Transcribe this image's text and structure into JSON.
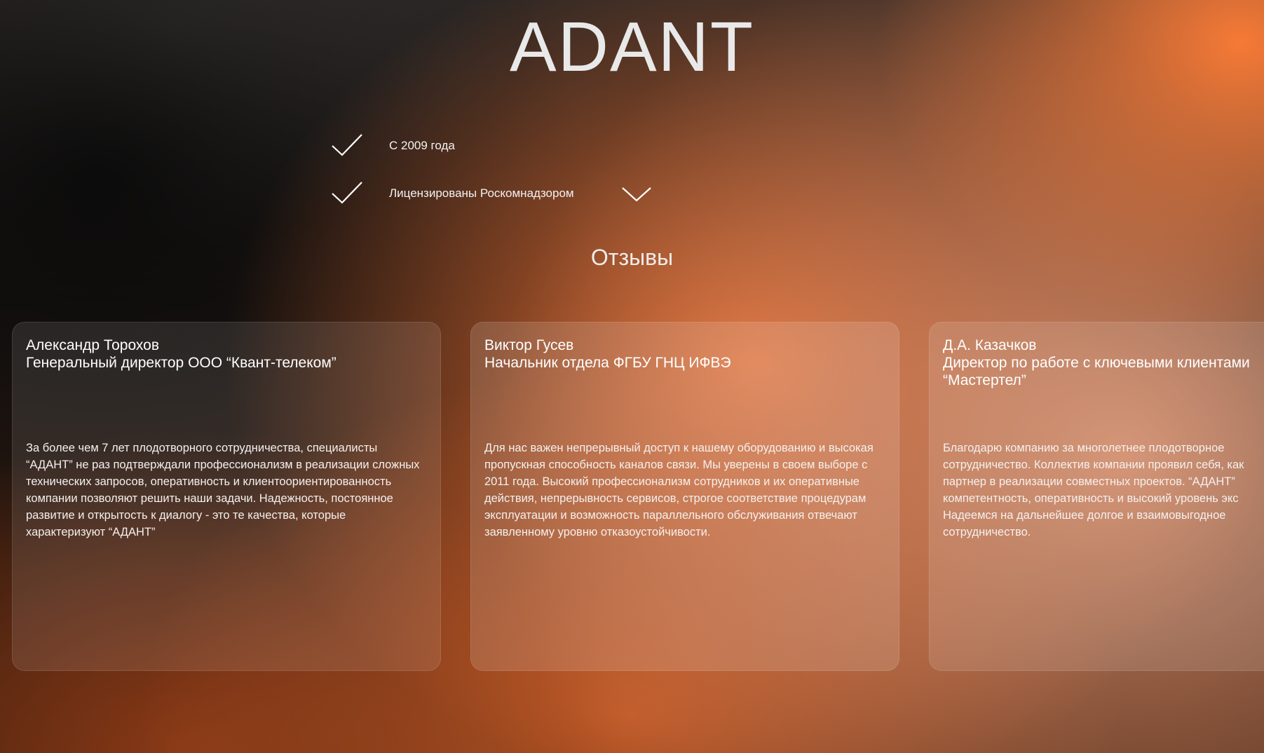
{
  "brand": {
    "title": "ADANT"
  },
  "features": [
    {
      "label": "С 2009 года",
      "icon": "check-icon"
    },
    {
      "label": "Лицензированы Роскомнадзором",
      "icon": "check-icon"
    }
  ],
  "features_toggle": {
    "icon": "chevron-down-icon"
  },
  "reviews": {
    "title": "Отзывы",
    "items": [
      {
        "name": "Александр Торохов",
        "role": "Генеральный директор ООО “Квант-телеком”",
        "text": "За более чем 7 лет плодотворного сотрудничества, специалисты “АДАНТ” не раз подтверждали профессионализм в реализации сложных технических запросов, оперативность и клиентоориентированность компании позволяют решить наши задачи. Надежность, постоянное развитие и открытость к диалогу - это те качества, которые характеризуют “АДАНТ”"
      },
      {
        "name": "Виктор Гусев",
        "role": "Начальник отдела ФГБУ ГНЦ ИФВЭ",
        "text": "Для нас важен непрерывный доступ к нашему оборудованию и высокая пропускная способность каналов связи. Мы уверены в своем выборе с 2011 года. Высокий профессионализм сотрудников и их оперативные действия, непрерывность сервисов, строгое соответствие процедурам эксплуатации и возможность параллельного обслуживания отвечают заявленному уровню отказоустойчивости."
      },
      {
        "name": "Д.А. Казачков",
        "role": "Директор по работе с ключевыми клиентами\n“Мастертел”",
        "text": "Благодарю компанию за многолетнее плодотворное\nсотрудничество. Коллектив компании проявил себя, как\nпартнер в реализации совместных проектов. “АДАНТ”\nкомпетентность, оперативность и высокий уровень экс\nНадеемся на дальнейшее долгое и взаимовыгодное\nсотрудничество."
      }
    ]
  },
  "colors": {
    "accent": "#f07a3a",
    "dark": "#151515",
    "text": "#ffffff"
  }
}
